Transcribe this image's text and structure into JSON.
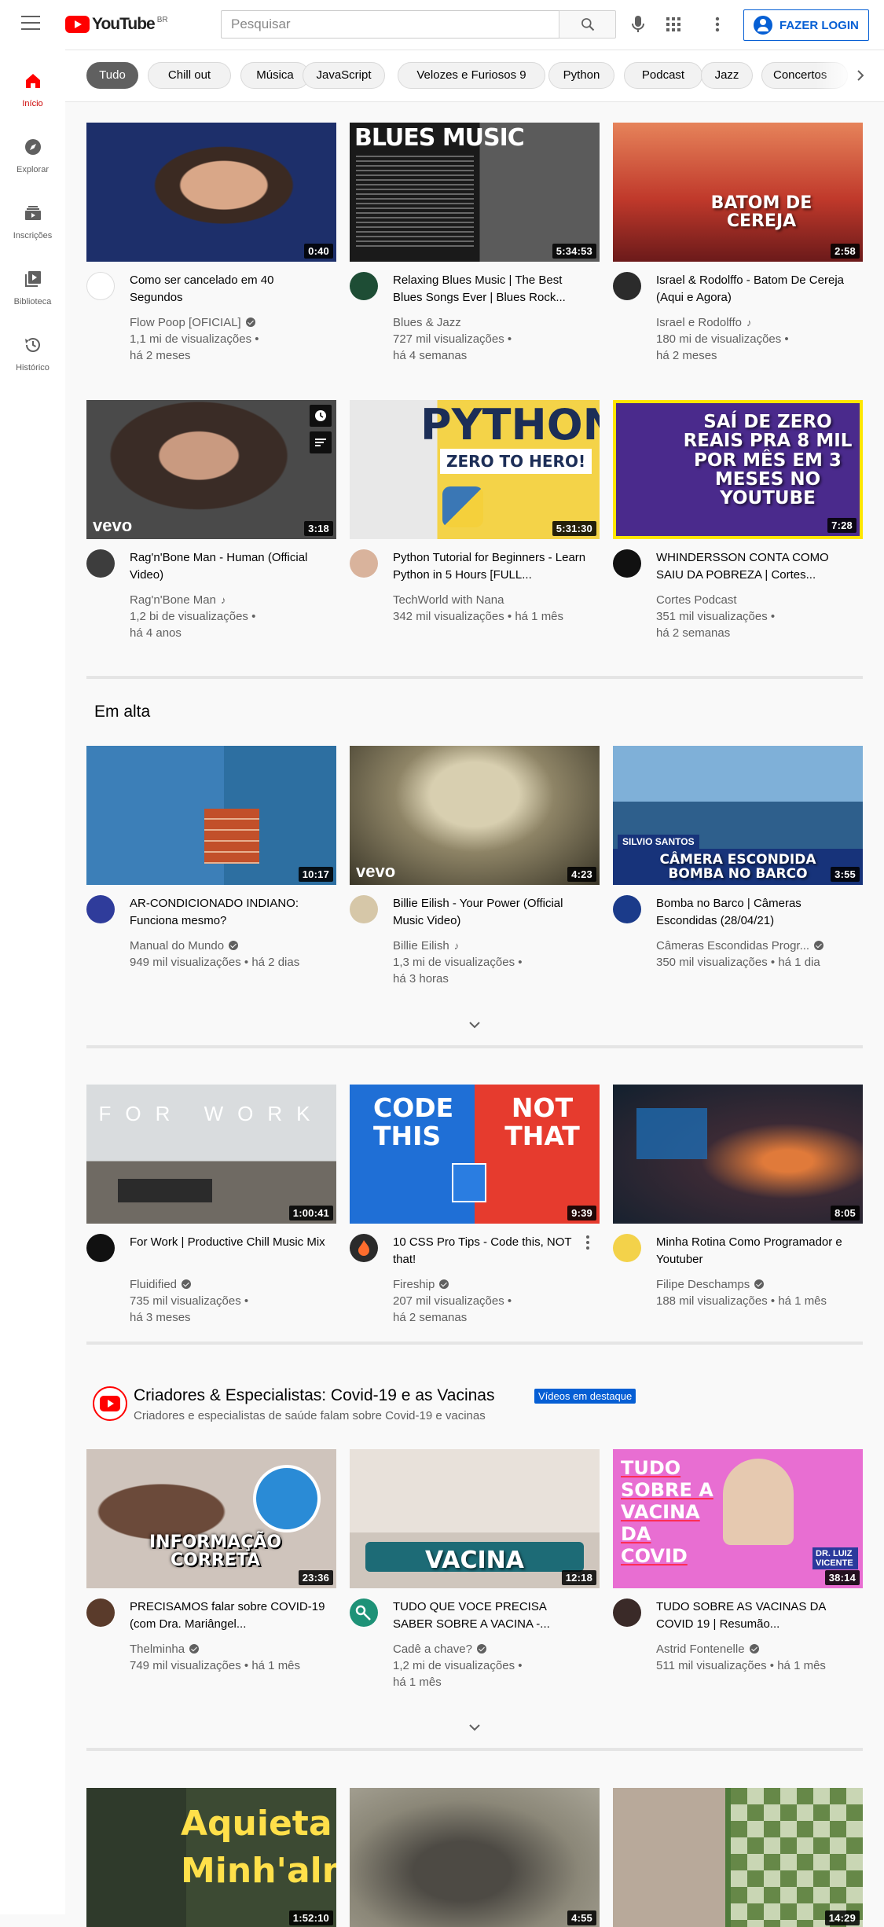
{
  "header": {
    "logo_text": "YouTube",
    "country_code": "BR",
    "search_placeholder": "Pesquisar",
    "login_label": "FAZER LOGIN"
  },
  "sidebar": {
    "items": [
      {
        "label": "Início",
        "icon": "home-icon",
        "active": true
      },
      {
        "label": "Explorar",
        "icon": "compass-icon",
        "active": false
      },
      {
        "label": "Inscrições",
        "icon": "subscriptions-icon",
        "active": false
      },
      {
        "label": "Biblioteca",
        "icon": "library-icon",
        "active": false
      },
      {
        "label": "Histórico",
        "icon": "history-icon",
        "active": false
      }
    ]
  },
  "chips": [
    "Tudo",
    "Chill out",
    "Música",
    "JavaScript",
    "Velozes e Furiosos 9",
    "Python",
    "Podcast",
    "Jazz",
    "Concertos"
  ],
  "colors": {
    "accent": "#ff0000",
    "link": "#065fd4",
    "secondary_text": "#606060"
  },
  "videos": [
    {
      "title": "Como ser cancelado em 40 Segundos",
      "channel": "Flow Poop [OFICIAL]",
      "verified": true,
      "music_note": false,
      "views": "1,1 mi de visualizações",
      "age": "há 2 meses",
      "duration": "0:40"
    },
    {
      "title": "Relaxing Blues Music | The Best Blues Songs Ever | Blues Rock...",
      "channel": "Blues & Jazz",
      "verified": false,
      "music_note": false,
      "views": "727 mil visualizações",
      "age": "há 4 semanas",
      "duration": "5:34:53",
      "thumb_text": "BLUES MUSIC"
    },
    {
      "title": "Israel & Rodolffo - Batom De Cereja (Aqui e Agora)",
      "channel": "Israel e Rodolffo",
      "verified": false,
      "music_note": true,
      "views": "180 mi de visualizações",
      "age": "há 2 meses",
      "duration": "2:58",
      "thumb_text": "BATOM DE CEREJA"
    },
    {
      "title": "Rag'n'Bone Man - Human (Official Video)",
      "channel": "Rag'n'Bone Man",
      "verified": false,
      "music_note": true,
      "views": "1,2 bi de visualizações",
      "age": "há 4 anos",
      "duration": "3:18",
      "thumb_text": "vevo"
    },
    {
      "title": "Python Tutorial for Beginners - Learn Python in 5 Hours [FULL...",
      "channel": "TechWorld with Nana",
      "verified": false,
      "music_note": false,
      "views": "342 mil visualizações",
      "age": "há 1 mês",
      "duration": "5:31:30",
      "thumb_text": "PYTHON",
      "thumb_text2": "ZERO TO HERO!"
    },
    {
      "title": "WHINDERSSON CONTA COMO SAIU DA POBREZA | Cortes...",
      "channel": "Cortes Podcast",
      "verified": false,
      "music_note": false,
      "views": "351 mil visualizações",
      "age": "há 2 semanas",
      "duration": "7:28",
      "thumb_text": "SAÍ DE ZERO REAIS PRA 8 MIL POR MÊS EM 3 MESES NO YOUTUBE"
    }
  ],
  "trending": {
    "title": "Em alta",
    "videos": [
      {
        "title": "AR-CONDICIONADO INDIANO: Funciona mesmo?",
        "channel": "Manual do Mundo",
        "verified": true,
        "views": "949 mil visualizações",
        "age": "há 2 dias",
        "duration": "10:17"
      },
      {
        "title": "Billie Eilish - Your Power (Official Music Video)",
        "channel": "Billie Eilish",
        "verified": false,
        "music_note": true,
        "views": "1,3 mi de visualizações",
        "age": "há 3 horas",
        "duration": "4:23",
        "thumb_text": "vevo"
      },
      {
        "title": "Bomba no Barco | Câmeras Escondidas (28/04/21)",
        "channel": "Câmeras Escondidas Progr...",
        "verified": true,
        "views": "350 mil visualizações",
        "age": "há 1 dia",
        "duration": "3:55",
        "thumb_text": "CÂMERA ESCONDIDA BOMBA NO BARCO",
        "thumb_text2": "SILVIO SANTOS"
      }
    ]
  },
  "more_videos": [
    {
      "title": "For Work | Productive Chill Music Mix",
      "channel": "Fluidified",
      "verified": true,
      "views": "735 mil visualizações",
      "age": "há 3 meses",
      "duration": "1:00:41",
      "thumb_text": "FOR WORK"
    },
    {
      "title": "10 CSS Pro Tips - Code this, NOT that!",
      "channel": "Fireship",
      "verified": true,
      "views": "207 mil visualizações",
      "age": "há 2 semanas",
      "duration": "9:39",
      "thumb_text": "CODE THIS",
      "thumb_text2": "NOT THAT"
    },
    {
      "title": "Minha Rotina Como Programador e Youtuber",
      "channel": "Filipe Deschamps",
      "verified": true,
      "views": "188 mil visualizações",
      "age": "há 1 mês",
      "duration": "8:05"
    }
  ],
  "covid_shelf": {
    "title": "Criadores & Especialistas: Covid-19 e as Vacinas",
    "badge": "Vídeos em destaque",
    "subtitle": "Criadores e especialistas de saúde falam sobre Covid-19 e vacinas",
    "videos": [
      {
        "title": "PRECISAMOS falar sobre COVID-19 (com Dra. Mariângel...",
        "channel": "Thelminha",
        "verified": true,
        "views": "749 mil visualizações",
        "age": "há 1 mês",
        "duration": "23:36",
        "thumb_text": "INFORMAÇÃO CORRETA"
      },
      {
        "title": "TUDO QUE VOCE PRECISA SABER SOBRE A VACINA -...",
        "channel": "Cadê a chave?",
        "verified": true,
        "views": "1,2 mi de visualizações",
        "age": "há 1 mês",
        "duration": "12:18",
        "thumb_text": "VACINA"
      },
      {
        "title": "TUDO SOBRE AS VACINAS DA COVID 19 | Resumão...",
        "channel": "Astrid Fontenelle",
        "verified": true,
        "views": "511 mil visualizações",
        "age": "há 1 mês",
        "duration": "38:14",
        "thumb_text": "TUDO SOBRE A VACINA DA COVID",
        "thumb_text2": "DR. LUIZ VICENTE"
      }
    ]
  },
  "bottom_videos": [
    {
      "duration": "1:52:10",
      "thumb_text": "Aquieta Minh'alma"
    },
    {
      "duration": "4:55"
    },
    {
      "duration": "14:29"
    }
  ]
}
